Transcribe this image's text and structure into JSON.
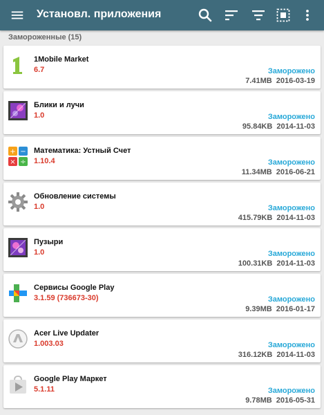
{
  "toolbar": {
    "title": "Установл. приложения",
    "icons": [
      "menu-icon",
      "search-icon",
      "sort-icon",
      "filter-icon",
      "select-all-icon",
      "more-vert-icon"
    ]
  },
  "section": {
    "header": "Замороженные (15)"
  },
  "apps": [
    {
      "name": "1Mobile Market",
      "version": "6.7",
      "status": "Заморожено",
      "size": "7.41MB",
      "date": "2016-03-19",
      "icon": "onemobile-icon"
    },
    {
      "name": "Блики и лучи",
      "version": "1.0",
      "status": "Заморожено",
      "size": "95.84KB",
      "date": "2014-11-03",
      "icon": "wallpaper-icon"
    },
    {
      "name": "Математика: Устный Счет",
      "version": "1.10.4",
      "status": "Заморожено",
      "size": "11.34MB",
      "date": "2016-06-21",
      "icon": "math-icon"
    },
    {
      "name": "Обновление системы",
      "version": "1.0",
      "status": "Заморожено",
      "size": "415.79KB",
      "date": "2014-11-03",
      "icon": "system-update-icon"
    },
    {
      "name": "Пузыри",
      "version": "1.0",
      "status": "Заморожено",
      "size": "100.31KB",
      "date": "2014-11-03",
      "icon": "wallpaper-icon"
    },
    {
      "name": "Сервисы Google Play",
      "version": "3.1.59 (736673-30)",
      "status": "Заморожено",
      "size": "9.39MB",
      "date": "2016-01-17",
      "icon": "google-play-services-icon"
    },
    {
      "name": "Acer Live Updater",
      "version": "1.003.03",
      "status": "Заморожено",
      "size": "316.12KB",
      "date": "2014-11-03",
      "icon": "acer-updater-icon"
    },
    {
      "name": "Google Play Маркет",
      "version": "5.1.11",
      "status": "Заморожено",
      "size": "9.78MB",
      "date": "2016-05-31",
      "icon": "google-play-store-icon"
    }
  ],
  "colors": {
    "toolbar": "#3f6b7c",
    "version": "#d93a2b",
    "status": "#29a9d8",
    "background": "#ececec"
  }
}
